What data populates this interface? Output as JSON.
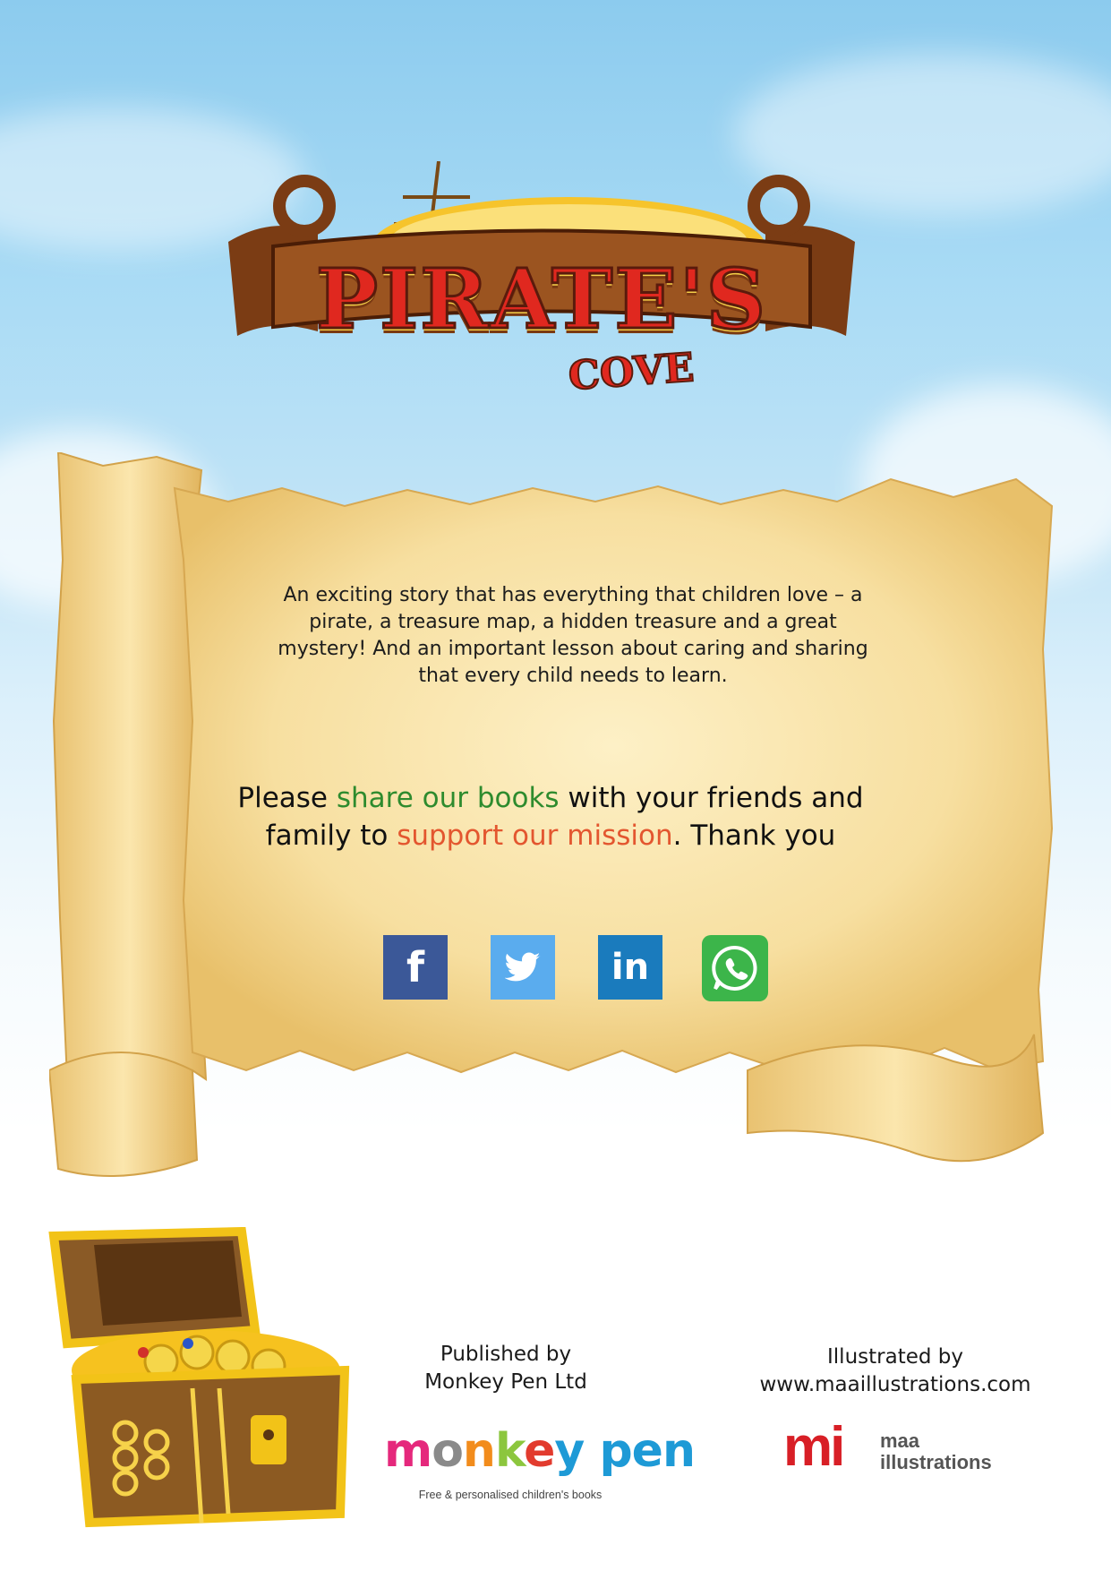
{
  "logo": {
    "title": "PIRATE'S",
    "subtitle": "COVE"
  },
  "description": "An exciting story that has everything that children love – a pirate, a treasure map, a hidden treasure and a great mystery!  And an important lesson about caring and sharing that every child needs to learn.",
  "share": {
    "part1": "Please ",
    "highlight1": "share our books",
    "part2": " with your friends and family to ",
    "highlight2": "support our mission",
    "part3": ". Thank you"
  },
  "social": {
    "facebook": "f",
    "twitter_icon": "twitter-bird-icon",
    "linkedin": "in",
    "whatsapp_icon": "whatsapp-icon"
  },
  "publisher": {
    "line1": "Published by",
    "line2": "Monkey Pen Ltd"
  },
  "monkey_pen_logo": {
    "letters": [
      "m",
      "o",
      "n",
      "k",
      "e",
      "y",
      " ",
      "p",
      "e",
      "n"
    ],
    "tagline": "Free & personalised children's books"
  },
  "illustrator": {
    "line1": "Illustrated by",
    "line2": "www.maaillustrations.com"
  },
  "maa_logo": {
    "mark": "mi",
    "line1": "maa",
    "line2": "illustrations"
  },
  "colors": {
    "sky": "#a9dbf5",
    "parchment": "#f6dea2",
    "green_highlight": "#2e8b2e",
    "red_highlight": "#e3562f",
    "facebook": "#3b5898",
    "twitter": "#5aacee",
    "linkedin": "#1a7bbd",
    "whatsapp": "#3cb54a",
    "maa_red": "#d81f26"
  }
}
